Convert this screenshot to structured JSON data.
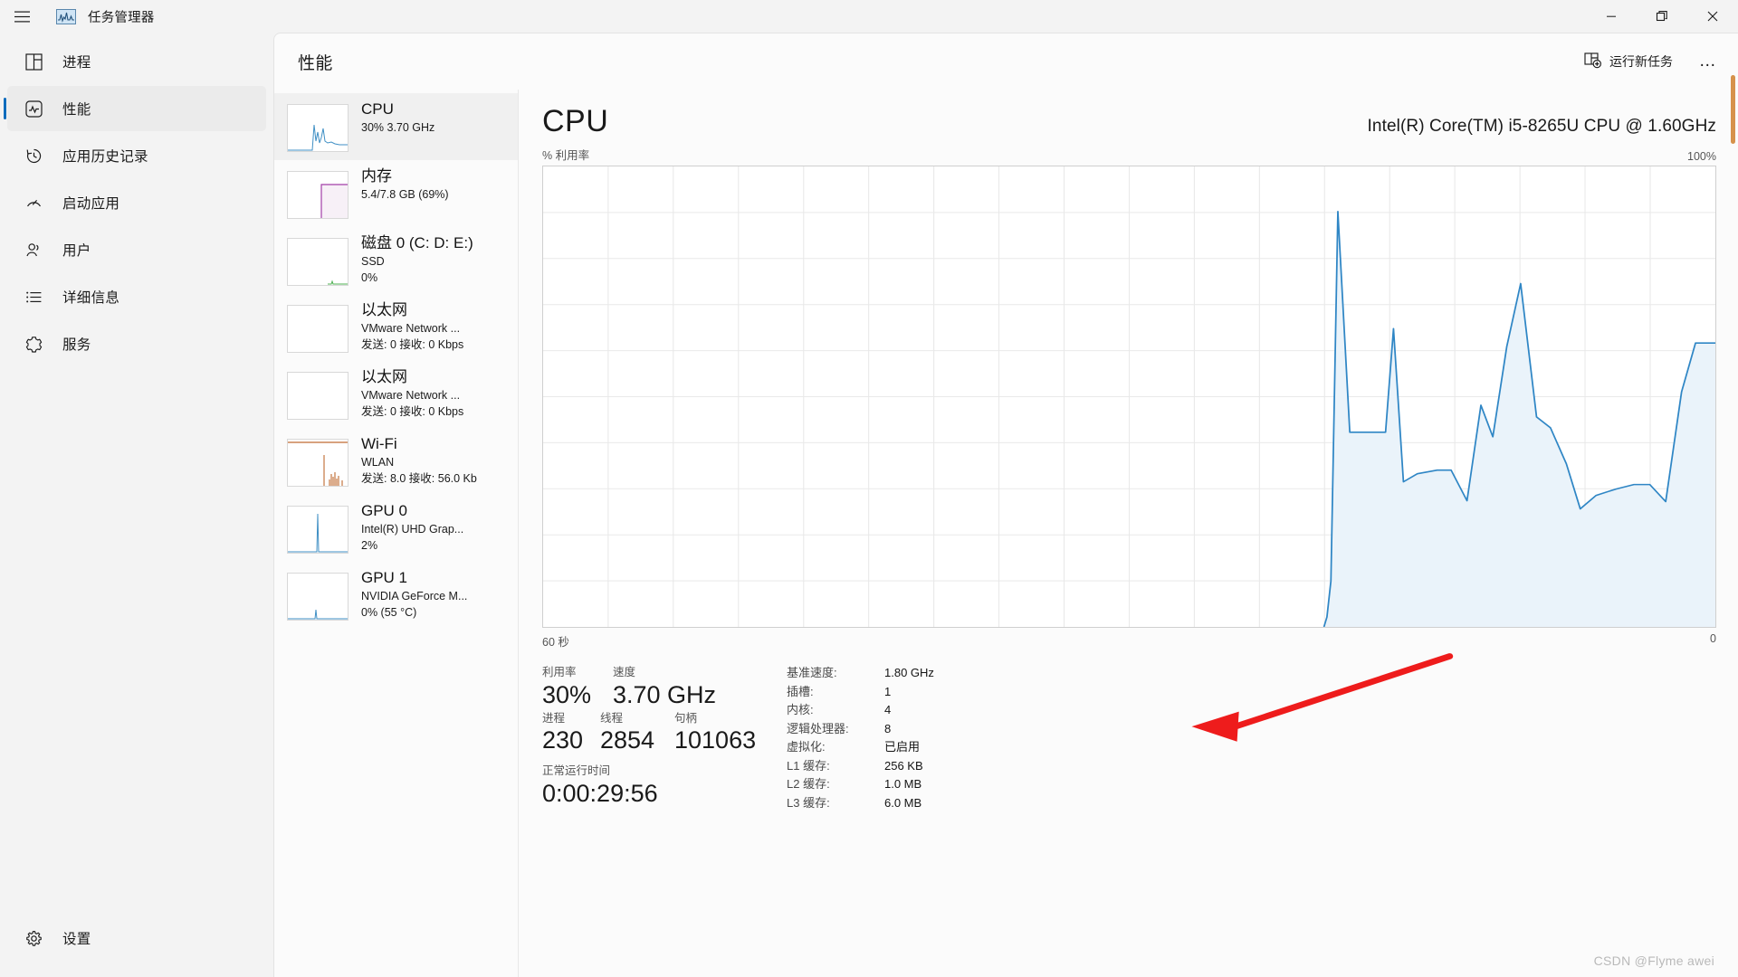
{
  "window": {
    "title": "任务管理器",
    "menu_icon": "hamburger-icon",
    "app_icon": "task-manager-icon",
    "controls": {
      "minimize": "—",
      "maximize": "❐",
      "close": "✕"
    }
  },
  "sidebar": {
    "items": [
      {
        "label": "进程",
        "icon": "processes-icon",
        "active": false
      },
      {
        "label": "性能",
        "icon": "performance-icon",
        "active": true
      },
      {
        "label": "应用历史记录",
        "icon": "history-icon",
        "active": false
      },
      {
        "label": "启动应用",
        "icon": "startup-icon",
        "active": false
      },
      {
        "label": "用户",
        "icon": "users-icon",
        "active": false
      },
      {
        "label": "详细信息",
        "icon": "details-icon",
        "active": false
      },
      {
        "label": "服务",
        "icon": "services-icon",
        "active": false
      }
    ],
    "settings": {
      "label": "设置",
      "icon": "gear-icon"
    }
  },
  "header": {
    "title": "性能",
    "run_task_label": "运行新任务",
    "run_task_icon": "add-task-icon",
    "more_label": "…"
  },
  "resources": [
    {
      "name": "CPU",
      "lines": [
        "30%  3.70 GHz"
      ],
      "active": true,
      "color": "#3f8fc4",
      "thumb": "sparkline-cpu"
    },
    {
      "name": "内存",
      "lines": [
        "5.4/7.8 GB (69%)"
      ],
      "active": false,
      "color": "#a23fa8",
      "thumb": "sparkline-memory"
    },
    {
      "name": "磁盘 0 (C: D: E:)",
      "lines": [
        "SSD",
        "0%"
      ],
      "active": false,
      "color": "#4caf50",
      "thumb": "sparkline-disk"
    },
    {
      "name": "以太网",
      "lines": [
        "VMware Network ...",
        "发送: 0 接收: 0 Kbps"
      ],
      "active": false,
      "color": "#7a7a7a",
      "thumb": "sparkline-ethernet"
    },
    {
      "name": "以太网",
      "lines": [
        "VMware Network ...",
        "发送: 0 接收: 0 Kbps"
      ],
      "active": false,
      "color": "#7a7a7a",
      "thumb": "sparkline-ethernet"
    },
    {
      "name": "Wi-Fi",
      "lines": [
        "WLAN",
        "发送: 8.0 接收: 56.0 Kb"
      ],
      "active": false,
      "color": "#c06a30",
      "thumb": "sparkline-wifi"
    },
    {
      "name": "GPU 0",
      "lines": [
        "Intel(R) UHD Grap...",
        "2%"
      ],
      "active": false,
      "color": "#3f8fc4",
      "thumb": "sparkline-gpu0"
    },
    {
      "name": "GPU 1",
      "lines": [
        "NVIDIA GeForce M...",
        "0% (55 °C)"
      ],
      "active": false,
      "color": "#3f8fc4",
      "thumb": "sparkline-gpu1"
    }
  ],
  "detail": {
    "name": "CPU",
    "model": "Intel(R) Core(TM) i5-8265U CPU @ 1.60GHz",
    "graph_top_left": "% 利用率",
    "graph_top_right": "100%",
    "graph_bottom_left": "60 秒",
    "graph_bottom_right": "0",
    "stats": [
      {
        "label": "利用率",
        "value": "30%"
      },
      {
        "label": "速度",
        "value": "3.70 GHz"
      },
      {
        "label": "进程",
        "value": "230"
      },
      {
        "label": "线程",
        "value": "2854"
      },
      {
        "label": "句柄",
        "value": "101063"
      }
    ],
    "uptime": {
      "label": "正常运行时间",
      "value": "0:00:29:56"
    },
    "specs": [
      {
        "key": "基准速度:",
        "value": "1.80 GHz"
      },
      {
        "key": "插槽:",
        "value": "1"
      },
      {
        "key": "内核:",
        "value": "4"
      },
      {
        "key": "逻辑处理器:",
        "value": "8"
      },
      {
        "key": "虚拟化:",
        "value": "已启用"
      },
      {
        "key": "L1 缓存:",
        "value": "256 KB"
      },
      {
        "key": "L2 缓存:",
        "value": "1.0 MB"
      },
      {
        "key": "L3 缓存:",
        "value": "6.0 MB"
      }
    ]
  },
  "annotation": {
    "color": "#ee1c1c",
    "target": "虚拟化 已启用"
  },
  "watermark": "CSDN @Flyme awei",
  "chart_data": {
    "type": "area",
    "title": "CPU % 利用率",
    "ylabel": "% 利用率",
    "xlabel": "60 秒",
    "ylim": [
      0,
      100
    ],
    "xlim": [
      60,
      0
    ],
    "grid": true,
    "line_color": "#3f8fc4",
    "fill_color": "#eaf3fa",
    "series": [
      {
        "name": "CPU 利用率",
        "values": [
          0,
          0,
          0,
          0,
          0,
          0,
          0,
          0,
          0,
          0,
          0,
          0,
          0,
          0,
          0,
          0,
          0,
          0,
          0,
          0,
          0,
          0,
          0,
          0,
          0,
          0,
          0,
          0,
          0,
          0,
          0,
          0,
          0,
          0,
          0,
          0,
          0,
          0,
          2,
          82,
          35,
          35,
          52,
          22,
          24,
          24,
          22,
          16,
          30,
          25,
          55,
          43,
          31,
          27,
          13,
          16,
          19,
          20,
          21,
          21,
          17,
          49
        ]
      }
    ]
  }
}
